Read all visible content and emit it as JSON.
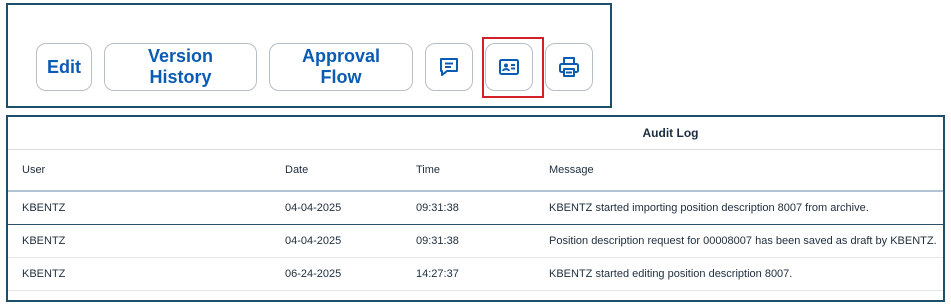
{
  "toolbar": {
    "edit_label": "Edit",
    "version_history_label": "Version History",
    "approval_flow_label": "Approval Flow",
    "icons": [
      "comment-icon",
      "profile-card-icon",
      "print-icon"
    ],
    "accent_color": "#0a5bb3",
    "highlight_color": "#d21f28"
  },
  "audit_log": {
    "title": "Audit Log",
    "columns": [
      "User",
      "Date",
      "Time",
      "Message"
    ],
    "rows": [
      {
        "user": "KBENTZ",
        "date": "04-04-2025",
        "time": "09:31:38",
        "message": "KBENTZ started importing position description 8007 from archive."
      },
      {
        "user": "KBENTZ",
        "date": "04-04-2025",
        "time": "09:31:38",
        "message": "Position description request for 00008007 has been saved as draft by KBENTZ."
      },
      {
        "user": "KBENTZ",
        "date": "06-24-2025",
        "time": "14:27:37",
        "message": "KBENTZ started editing position description 8007."
      }
    ]
  }
}
